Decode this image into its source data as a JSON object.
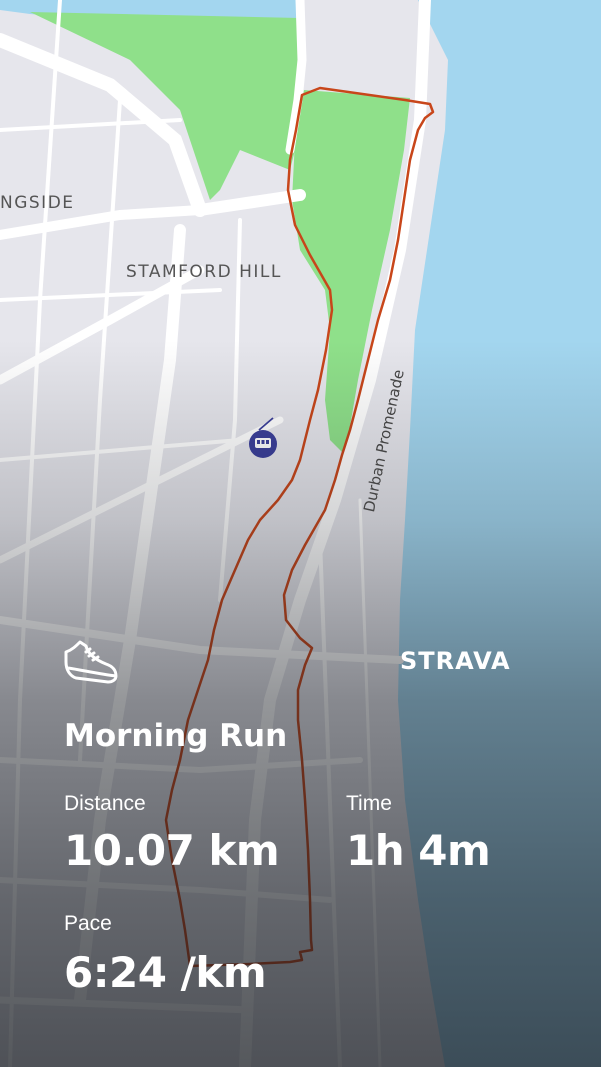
{
  "map": {
    "neighborhood_labels": [
      "NGSIDE",
      "STAMFORD HILL"
    ],
    "street_label": "Durban Promenade",
    "poi_icon": "cable-car-icon",
    "colors": {
      "sea": "#a3d6ef",
      "park": "#8fe08a",
      "land": "#e6e6ec",
      "road": "#ffffff",
      "route": "#c8461a"
    }
  },
  "brand": {
    "name": "STRAVA"
  },
  "activity": {
    "icon": "running-shoe-icon",
    "title": "Morning Run",
    "stats": {
      "distance": {
        "label": "Distance",
        "value": "10.07 km"
      },
      "time": {
        "label": "Time",
        "value": "1h 4m"
      },
      "pace": {
        "label": "Pace",
        "value": "6:24 /km"
      }
    }
  }
}
